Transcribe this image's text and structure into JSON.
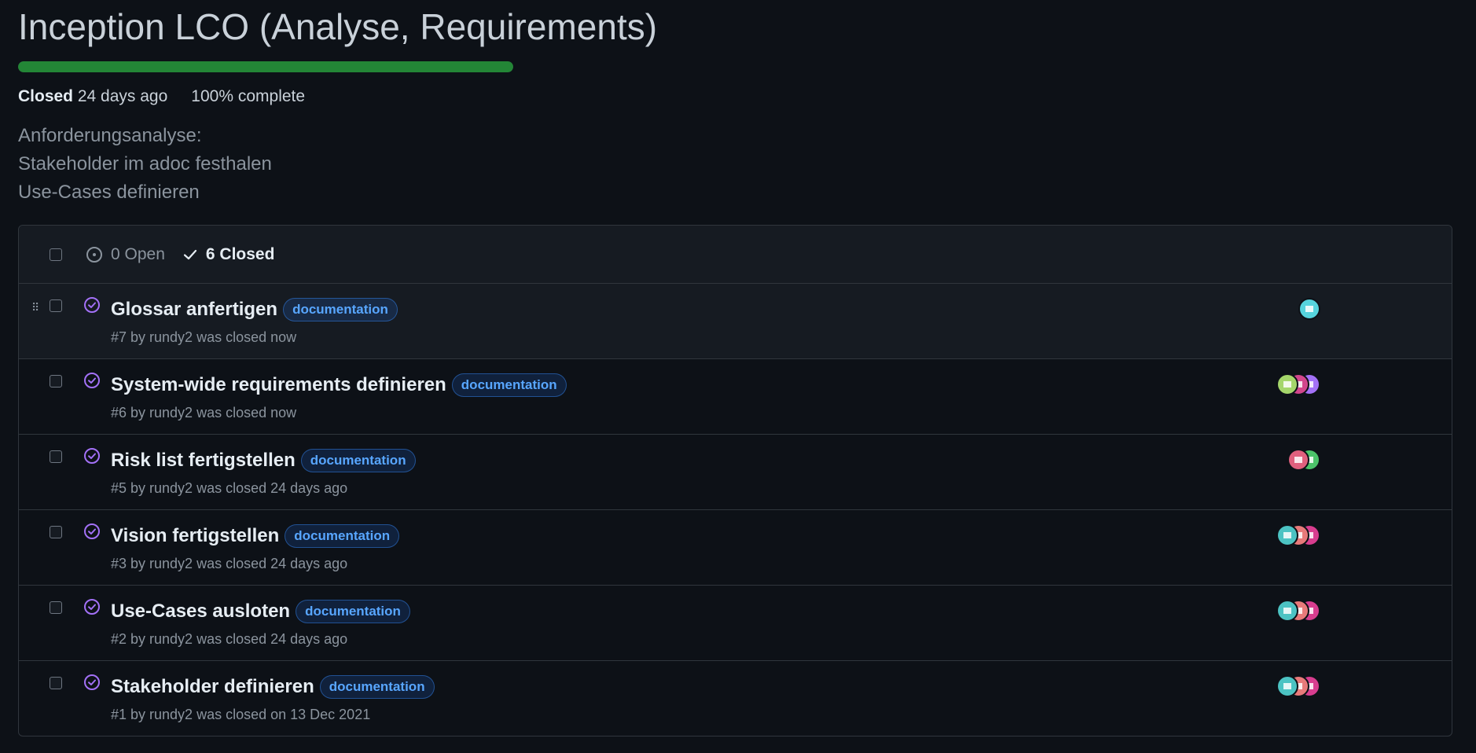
{
  "milestone": {
    "title": "Inception LCO (Analyse, Requirements)",
    "progress_percent": 100,
    "status": "Closed",
    "closed_ago": "24 days ago",
    "complete_text": "100% complete",
    "description": [
      "Anforderungsanalyse:",
      "Stakeholder im adoc festhalen",
      "Use-Cases definieren"
    ]
  },
  "tabs": {
    "open": "0 Open",
    "closed": "6 Closed"
  },
  "colors": {
    "progress": "#238636",
    "closed_icon": "#a371f7",
    "label": "#58a6ff"
  },
  "issues": [
    {
      "title": "Glossar anfertigen",
      "label": "documentation",
      "meta": "#7 by rundy2 was closed now",
      "avatars": [
        "#56d4dd"
      ]
    },
    {
      "title": "System-wide requirements definieren",
      "label": "documentation",
      "meta": "#6 by rundy2 was closed now",
      "avatars": [
        "#a371f7",
        "#d2468c",
        "#a5d66b"
      ]
    },
    {
      "title": "Risk list fertigstellen",
      "label": "documentation",
      "meta": "#5 by rundy2 was closed 24 days ago",
      "avatars": [
        "#4cc36a",
        "#e0607e"
      ]
    },
    {
      "title": "Vision fertigstellen",
      "label": "documentation",
      "meta": "#3 by rundy2 was closed 24 days ago",
      "avatars": [
        "#d83d8f",
        "#e87a7a",
        "#4cc3c3"
      ]
    },
    {
      "title": "Use-Cases ausloten",
      "label": "documentation",
      "meta": "#2 by rundy2 was closed 24 days ago",
      "avatars": [
        "#d83d8f",
        "#e87a7a",
        "#4cc3c3"
      ]
    },
    {
      "title": "Stakeholder definieren",
      "label": "documentation",
      "meta": "#1 by rundy2 was closed on 13 Dec 2021",
      "avatars": [
        "#d83d8f",
        "#e87a7a",
        "#4cc3c3"
      ]
    }
  ]
}
